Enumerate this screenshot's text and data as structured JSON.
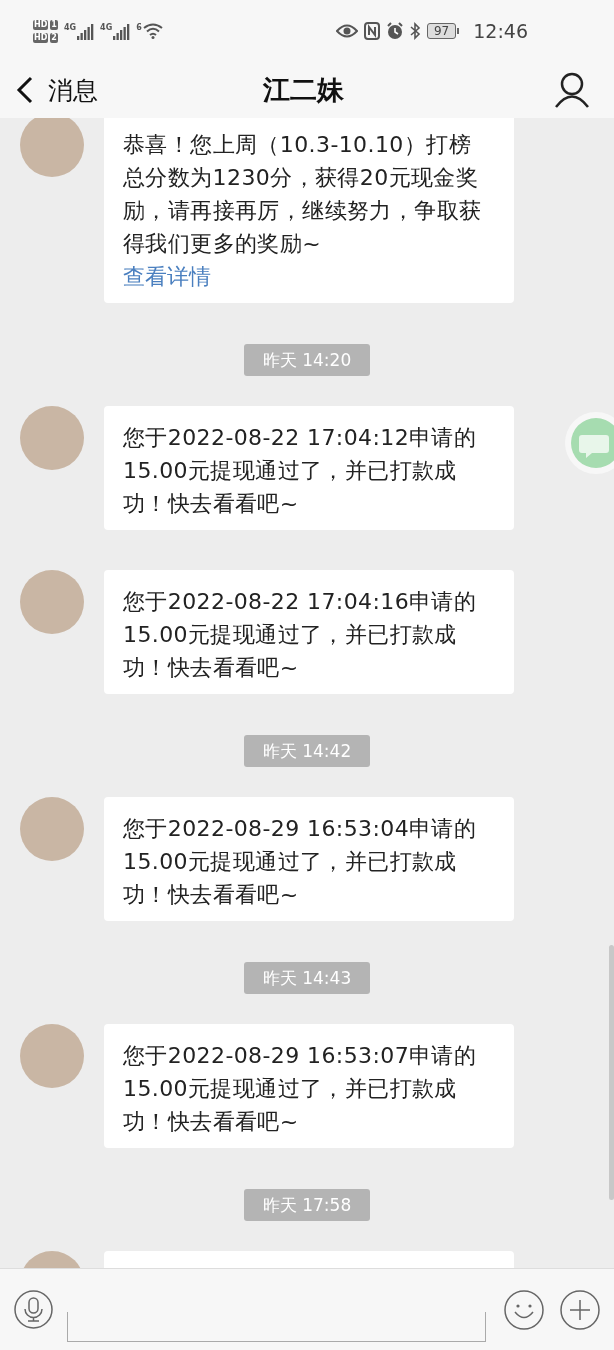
{
  "status_bar": {
    "sims": [
      {
        "label": "HD",
        "slot": "1"
      },
      {
        "label": "HD",
        "slot": "2"
      }
    ],
    "signals": [
      {
        "label": "4G"
      },
      {
        "label": "4G"
      }
    ],
    "wifi_label": "6",
    "battery": "97",
    "time": "12:46"
  },
  "nav": {
    "back_label": "消息",
    "title": "江二妹"
  },
  "chat": [
    {
      "kind": "message",
      "text": "恭喜！您上周（10.3-10.10）打榜总分数为1230分，获得20元现金奖励，请再接再厉，继续努力，争取获得我们更多的奖励~",
      "link": "查看详情"
    },
    {
      "kind": "time",
      "text": "昨天 14:20"
    },
    {
      "kind": "message",
      "text": "您于2022-08-22 17:04:12申请的15.00元提现通过了，并已打款成功！快去看看吧~"
    },
    {
      "kind": "message",
      "text": "您于2022-08-22 17:04:16申请的15.00元提现通过了，并已打款成功！快去看看吧~"
    },
    {
      "kind": "time",
      "text": "昨天 14:42"
    },
    {
      "kind": "message",
      "text": "您于2022-08-29 16:53:04申请的15.00元提现通过了，并已打款成功！快去看看吧~"
    },
    {
      "kind": "time",
      "text": "昨天 14:43"
    },
    {
      "kind": "message",
      "text": "您于2022-08-29 16:53:07申请的15.00元提现通过了，并已打款成功！快去看看吧~"
    },
    {
      "kind": "time",
      "text": "昨天 17:58"
    },
    {
      "kind": "message"
    }
  ]
}
